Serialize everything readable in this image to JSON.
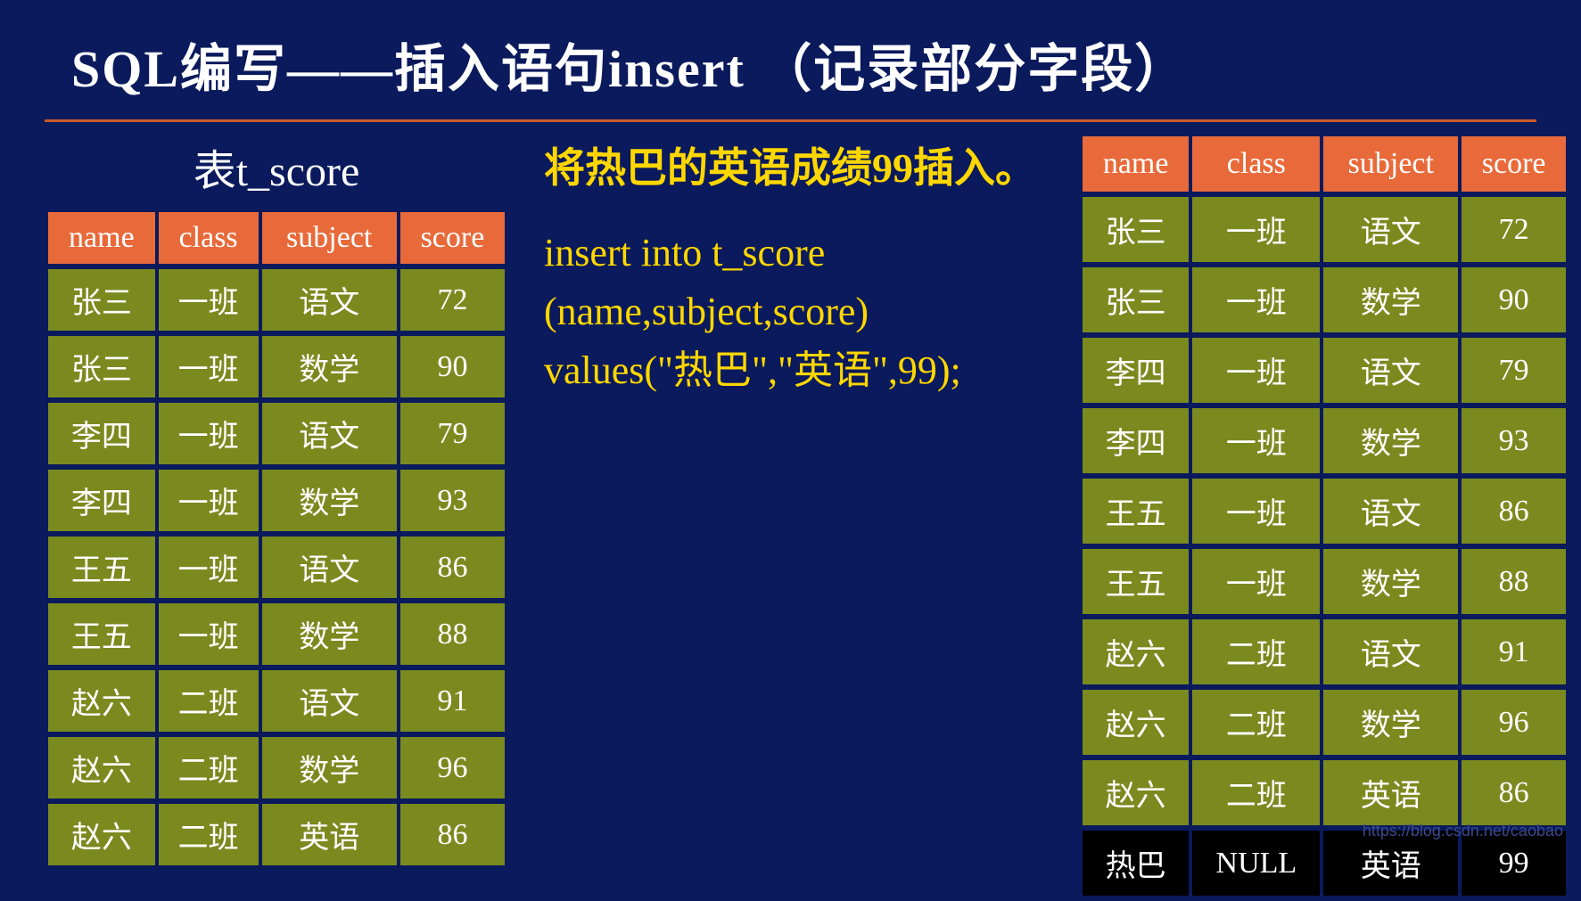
{
  "title": "SQL编写——插入语句insert （记录部分字段）",
  "left_caption": "表t_score",
  "headers": {
    "name": "name",
    "class": "class",
    "subject": "subject",
    "score": "score"
  },
  "left_rows": [
    {
      "name": "张三",
      "class": "一班",
      "subject": "语文",
      "score": "72"
    },
    {
      "name": "张三",
      "class": "一班",
      "subject": "数学",
      "score": "90"
    },
    {
      "name": "李四",
      "class": "一班",
      "subject": "语文",
      "score": "79"
    },
    {
      "name": "李四",
      "class": "一班",
      "subject": "数学",
      "score": "93"
    },
    {
      "name": "王五",
      "class": "一班",
      "subject": "语文",
      "score": "86"
    },
    {
      "name": "王五",
      "class": "一班",
      "subject": "数学",
      "score": "88"
    },
    {
      "name": "赵六",
      "class": "二班",
      "subject": "语文",
      "score": "91"
    },
    {
      "name": "赵六",
      "class": "二班",
      "subject": "数学",
      "score": "96"
    },
    {
      "name": "赵六",
      "class": "二班",
      "subject": "英语",
      "score": "86"
    }
  ],
  "right_rows": [
    {
      "name": "张三",
      "class": "一班",
      "subject": "语文",
      "score": "72"
    },
    {
      "name": "张三",
      "class": "一班",
      "subject": "数学",
      "score": "90"
    },
    {
      "name": "李四",
      "class": "一班",
      "subject": "语文",
      "score": "79"
    },
    {
      "name": "李四",
      "class": "一班",
      "subject": "数学",
      "score": "93"
    },
    {
      "name": "王五",
      "class": "一班",
      "subject": "语文",
      "score": "86"
    },
    {
      "name": "王五",
      "class": "一班",
      "subject": "数学",
      "score": "88"
    },
    {
      "name": "赵六",
      "class": "二班",
      "subject": "语文",
      "score": "91"
    },
    {
      "name": "赵六",
      "class": "二班",
      "subject": "数学",
      "score": "96"
    },
    {
      "name": "赵六",
      "class": "二班",
      "subject": "英语",
      "score": "86"
    }
  ],
  "inserted_row": {
    "name": "热巴",
    "class": "NULL",
    "subject": "英语",
    "score": "99"
  },
  "prompt": "将热巴的英语成绩99插入。",
  "sql": "insert into t_score (name,subject,score) values(\"热巴\",\"英语\",99);",
  "watermark": "https://blog.csdn.net/caobao"
}
